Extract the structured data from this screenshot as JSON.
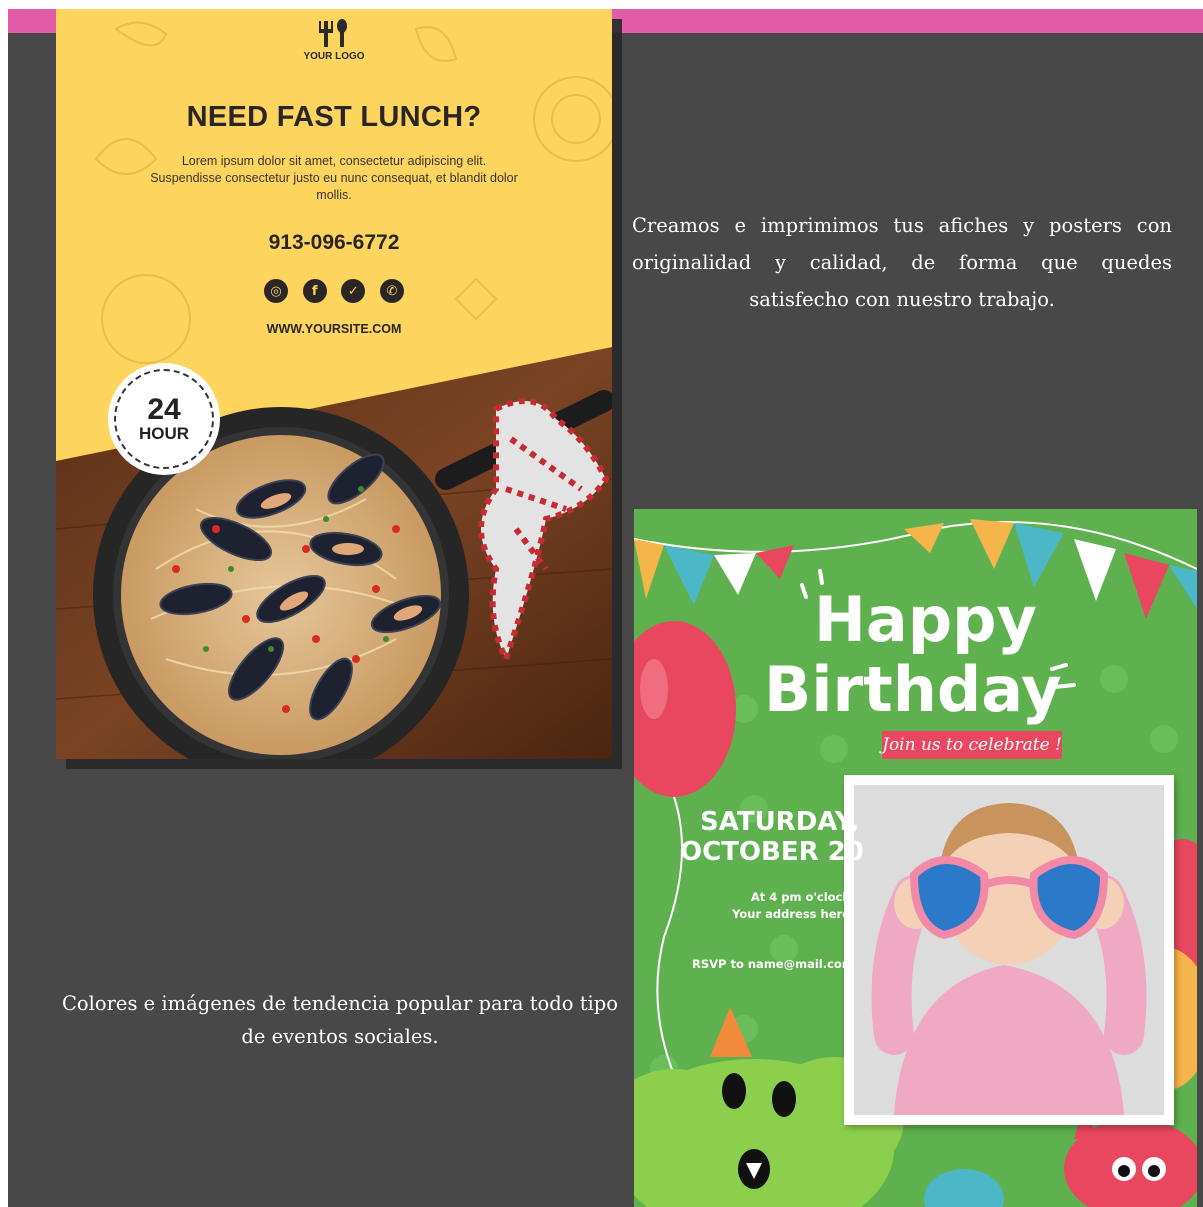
{
  "lunch_poster": {
    "logo_text": "YOUR LOGO",
    "title": "NEED FAST LUNCH?",
    "body": "Lorem ipsum dolor sit amet, consectetur adipiscing elit. Suspendisse consectetur justo eu nunc consequat, et blandit dolor mollis.",
    "phone": "913-096-6772",
    "social_icons": [
      "instagram-icon",
      "facebook-icon",
      "twitter-icon",
      "whatsapp-icon"
    ],
    "website": "WWW.YOURSITE.COM",
    "badge_number": "24",
    "badge_label": "HOUR"
  },
  "captions": {
    "top": "Creamos e imprimimos tus afiches y posters con originalidad y calidad, de forma que quedes satisfecho con nuestro trabajo.",
    "bottom": "Colores e imágenes de tendencia popular para todo tipo de eventos sociales."
  },
  "birthday_poster": {
    "line1": "Happy",
    "line2": "Birthday",
    "ribbon": "Join us to celebrate !",
    "date_line1": "SATURDAY,",
    "date_line2": "OCTOBER 20",
    "time_line1": "At 4 pm o'clock",
    "time_line2": "Your address here",
    "rsvp": "RSVP to name@mail.com"
  },
  "colors": {
    "background": "#484848",
    "accent_bar": "#e35ca8",
    "lunch_yellow": "#fdd45e",
    "birthday_green": "#5fb14f"
  }
}
